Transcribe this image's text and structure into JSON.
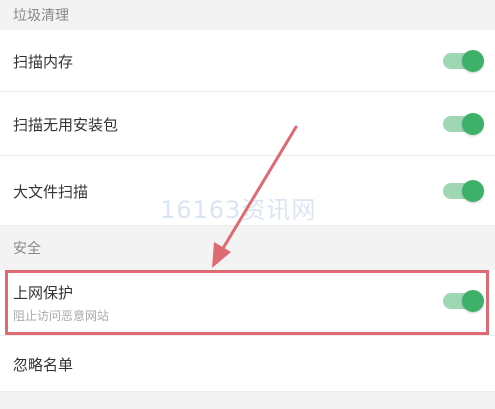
{
  "sections": [
    {
      "title": "垃圾清理",
      "items": [
        {
          "label": "扫描内存",
          "toggle_on": true
        },
        {
          "label": "扫描无用安装包",
          "toggle_on": true
        },
        {
          "label": "大文件扫描",
          "toggle_on": true
        }
      ]
    },
    {
      "title": "安全",
      "items": [
        {
          "label": "上网保护",
          "sublabel": "阻止访问恶意网站",
          "toggle_on": true
        },
        {
          "label": "忽略名单"
        }
      ]
    }
  ],
  "watermark": "16163资讯网",
  "colors": {
    "toggle_track": "#9fd6b4",
    "toggle_knob": "#3db06a",
    "highlight": "#e06a72",
    "background": "#f3f3f3"
  }
}
